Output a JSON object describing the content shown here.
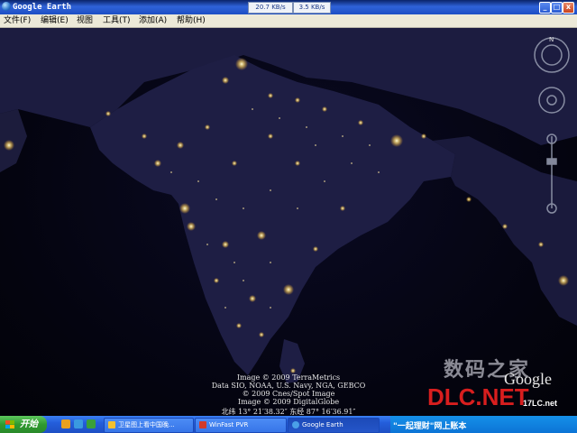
{
  "window": {
    "title": "Google Earth",
    "download_speed": "20.7 KB/s",
    "upload_speed": "3.5 KB/s",
    "min_label": "_",
    "max_label": "□",
    "close_label": "x"
  },
  "menu": [
    "文件(F)",
    "编辑(E)",
    "视图",
    "工具(T)",
    "添加(A)",
    "帮助(H)"
  ],
  "map": {
    "credits": [
      "Image © 2009 TerraMetrics",
      "Data SIO, NOAA, U.S. Navy, NGA, GEBCO",
      "© 2009 Cnes/Spot Image",
      "Image © 2009 DigitalGlobe"
    ],
    "coordinates": "北纬 13° 21′38.32″ 东经 87° 16′36.91″",
    "nav_north": "N",
    "google_logo": "Google",
    "watermark_text": "数码之家",
    "watermark_logo": "DLC.NET",
    "watermark_site": "17LC.net"
  },
  "taskbar": {
    "start_label": "开始",
    "tasks": [
      "卫星图上看中国晚...",
      "WinFast PVR",
      "Google Earth"
    ],
    "tray_text": "\"一起理财\"网上账本"
  },
  "colors": {
    "ocean": "#04040f",
    "land": "#1a1a3a",
    "city_light": "#fff4b0",
    "titlebar": "#2f62d8",
    "taskbar": "#245edb"
  }
}
